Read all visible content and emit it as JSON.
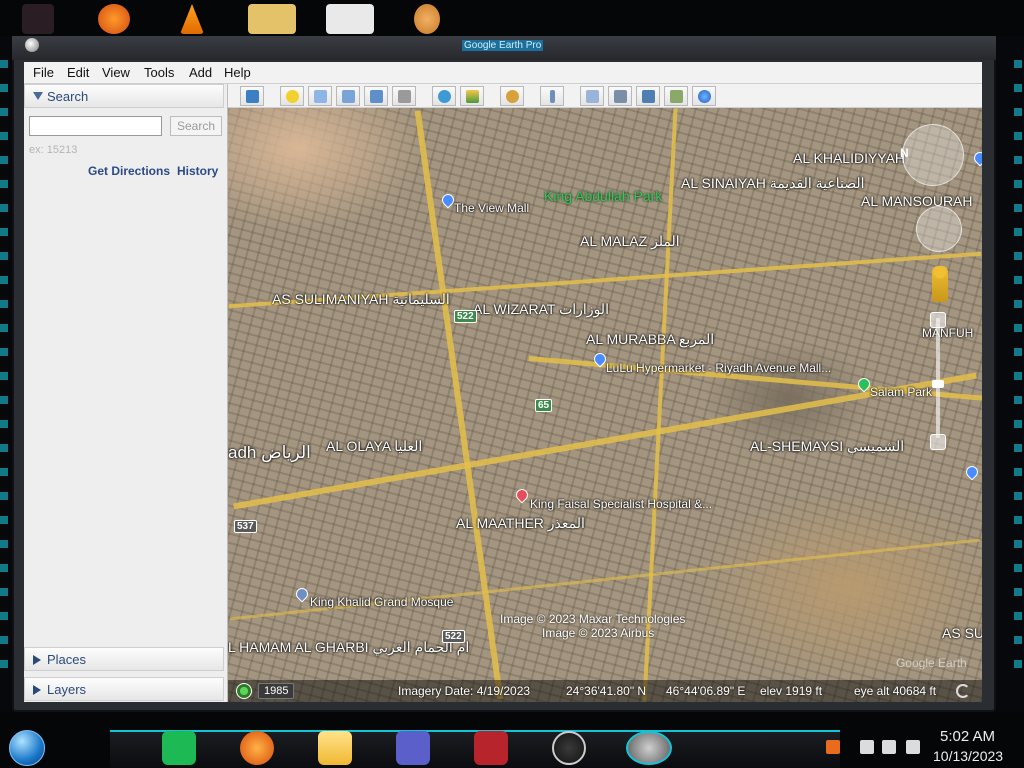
{
  "window": {
    "title": "Google Earth Pro"
  },
  "menubar": {
    "items": [
      "File",
      "Edit",
      "View",
      "Tools",
      "Add",
      "Help"
    ]
  },
  "sidebar": {
    "search_header": "Search",
    "search_button": "Search",
    "search_hint": "ex: 15213",
    "get_directions": "Get Directions",
    "history": "History",
    "places_header": "Places",
    "layers_header": "Layers"
  },
  "toolbar": {
    "icons": [
      "sidebar-toggle-icon",
      "placemark-icon",
      "polygon-icon",
      "path-icon",
      "image-overlay-icon",
      "record-tour-icon",
      "historical-imagery-icon",
      "sun-icon",
      "planets-icon",
      "ruler-icon",
      "email-icon",
      "print-icon",
      "save-image-icon",
      "view-in-maps-icon",
      "earth-icon"
    ]
  },
  "map": {
    "district_labels": [
      "AL KHALIDIYYAH",
      "AL SINAIYAH الصناعية القديمة",
      "AL MANSOURAH",
      "AL MALAZ الملز",
      "AS SULIMANIYAH السليمانية",
      "AL WIZARAT الوزارات",
      "AL MURABBA المربع",
      "adh الرياض",
      "AL OLAYA العليا",
      "AL-SHEMAYSI الشميسي",
      "AL MAATHER المعذر",
      "L HAMAM AL GHARBI ام الحمام الغربي",
      "AS SU",
      "MANFUH"
    ],
    "poi_labels": [
      "The View Mall",
      "LuLu Hypermarket - Riyadh Avenue Mall...",
      "Salam Park",
      "King Faisal Specialist Hospital &...",
      "King Khalid Grand Mosque"
    ],
    "park_labels": [
      "King Abdullah Park"
    ],
    "route_badges": [
      "522",
      "65",
      "537",
      "522"
    ],
    "attribution": [
      "Image © 2023 Maxar Technologies",
      "Image © 2023 Airbus"
    ],
    "watermark": "Google Earth",
    "north_letter": "N"
  },
  "status": {
    "year": "1985",
    "imagery_date": "Imagery Date: 4/19/2023",
    "latitude": "24°36'41.80\" N",
    "longitude": "46°44'06.89\" E",
    "elev": "elev  1919 ft",
    "eye_alt": "eye alt  40684 ft"
  },
  "taskbar": {
    "time": "5:02 AM",
    "date": "10/13/2023",
    "icons": [
      "start-orb-icon",
      "spotify-icon",
      "firefox-icon",
      "file-explorer-icon",
      "credit-card-app-icon",
      "desktop-app-icon",
      "obs-icon",
      "google-earth-pro-icon"
    ]
  }
}
